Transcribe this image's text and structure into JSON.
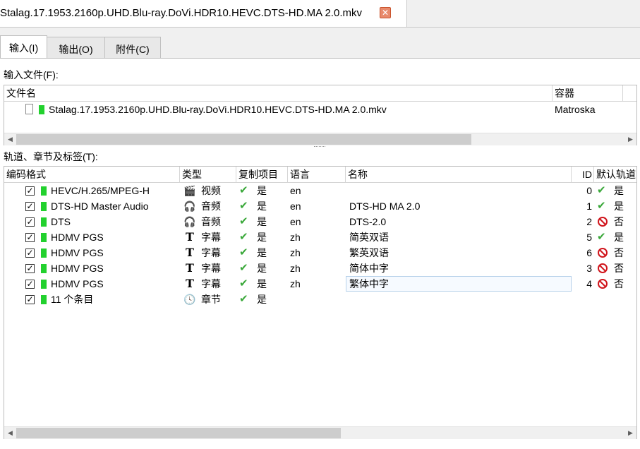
{
  "window": {
    "file_tab": "Stalag.17.1953.2160p.UHD.Blu-ray.DoVi.HDR10.HEVC.DTS-HD.MA 2.0.mkv",
    "close_glyph": "✕"
  },
  "tabs": [
    {
      "label": "输入(I)"
    },
    {
      "label": "输出(O)"
    },
    {
      "label": "附件(C)"
    }
  ],
  "input_files": {
    "label": "输入文件(F):",
    "columns": [
      "文件名",
      "容器"
    ],
    "rows": [
      {
        "name": "Stalag.17.1953.2160p.UHD.Blu-ray.DoVi.HDR10.HEVC.DTS-HD.MA 2.0.mkv",
        "container": "Matroska"
      }
    ]
  },
  "tracks": {
    "label": "轨道、章节及标签(T):",
    "columns": [
      "编码格式",
      "类型",
      "复制项目",
      "语言",
      "名称",
      "ID",
      "默认轨道"
    ],
    "rows": [
      {
        "codec": "HEVC/H.265/MPEG-H",
        "type": "视频",
        "type_icon": "video-icon",
        "copy": "是",
        "lang": "en",
        "name": "",
        "id": "0",
        "default": "是",
        "default_icon": "check-icon"
      },
      {
        "codec": "DTS-HD Master Audio",
        "type": "音频",
        "type_icon": "headphones-icon",
        "copy": "是",
        "lang": "en",
        "name": "DTS-HD MA 2.0",
        "id": "1",
        "default": "是",
        "default_icon": "check-icon"
      },
      {
        "codec": "DTS",
        "type": "音频",
        "type_icon": "headphones-icon",
        "copy": "是",
        "lang": "en",
        "name": "DTS-2.0",
        "id": "2",
        "default": "否",
        "default_icon": "no-icon"
      },
      {
        "codec": "HDMV PGS",
        "type": "字幕",
        "type_icon": "subtitle-icon",
        "copy": "是",
        "lang": "zh",
        "name": "简英双语",
        "id": "5",
        "default": "是",
        "default_icon": "check-icon"
      },
      {
        "codec": "HDMV PGS",
        "type": "字幕",
        "type_icon": "subtitle-icon",
        "copy": "是",
        "lang": "zh",
        "name": "繁英双语",
        "id": "6",
        "default": "否",
        "default_icon": "no-icon"
      },
      {
        "codec": "HDMV PGS",
        "type": "字幕",
        "type_icon": "subtitle-icon",
        "copy": "是",
        "lang": "zh",
        "name": "简体中字",
        "id": "3",
        "default": "否",
        "default_icon": "no-icon"
      },
      {
        "codec": "HDMV PGS",
        "type": "字幕",
        "type_icon": "subtitle-icon",
        "copy": "是",
        "lang": "zh",
        "name": "繁体中字",
        "id": "4",
        "default": "否",
        "default_icon": "no-icon"
      },
      {
        "codec": "11 个条目",
        "type": "章节",
        "type_icon": "clock-icon",
        "copy": "是",
        "lang": "",
        "name": "",
        "id": "",
        "default": "",
        "default_icon": ""
      }
    ]
  },
  "colors": {
    "green_marker": "#22d12e",
    "check": "#3aa83a",
    "no": "#d0141b",
    "close_button": "#e88a6c"
  }
}
